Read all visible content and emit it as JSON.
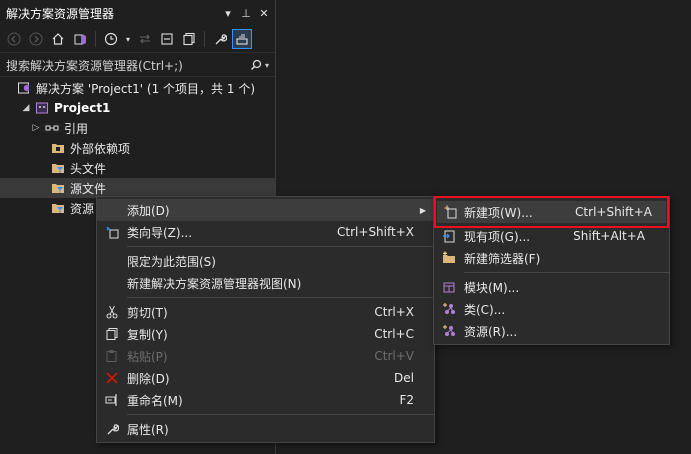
{
  "panel": {
    "title": "解决方案资源管理器",
    "controls": {
      "dropdown": "▾",
      "pin": "⊥",
      "close": "✕"
    }
  },
  "search": {
    "placeholder": "搜索解决方案资源管理器(Ctrl+;)"
  },
  "tree": {
    "solution": "解决方案 'Project1' (1 个项目，共 1 个)",
    "project": "Project1",
    "items": [
      "引用",
      "外部依赖项",
      "头文件",
      "源文件",
      "资源"
    ]
  },
  "context_menu": {
    "items": [
      {
        "label": "添加(D)",
        "shortcut": "",
        "submenu": true
      },
      {
        "label": "类向导(Z)...",
        "shortcut": "Ctrl+Shift+X"
      },
      {
        "label": "限定为此范围(S)",
        "shortcut": ""
      },
      {
        "label": "新建解决方案资源管理器视图(N)",
        "shortcut": ""
      },
      {
        "label": "剪切(T)",
        "shortcut": "Ctrl+X"
      },
      {
        "label": "复制(Y)",
        "shortcut": "Ctrl+C"
      },
      {
        "label": "粘贴(P)",
        "shortcut": "Ctrl+V",
        "disabled": true
      },
      {
        "label": "删除(D)",
        "shortcut": "Del"
      },
      {
        "label": "重命名(M)",
        "shortcut": "F2"
      },
      {
        "label": "属性(R)",
        "shortcut": ""
      }
    ]
  },
  "submenu": {
    "items": [
      {
        "label": "新建项(W)...",
        "shortcut": "Ctrl+Shift+A"
      },
      {
        "label": "现有项(G)...",
        "shortcut": "Shift+Alt+A"
      },
      {
        "label": "新建筛选器(F)",
        "shortcut": ""
      },
      {
        "label": "模块(M)...",
        "shortcut": ""
      },
      {
        "label": "类(C)...",
        "shortcut": ""
      },
      {
        "label": "资源(R)...",
        "shortcut": ""
      }
    ]
  },
  "colors": {
    "accent": "#3794ff",
    "highlight": "#e81123",
    "folder": "#dcb67a",
    "project": "#b180d7"
  }
}
